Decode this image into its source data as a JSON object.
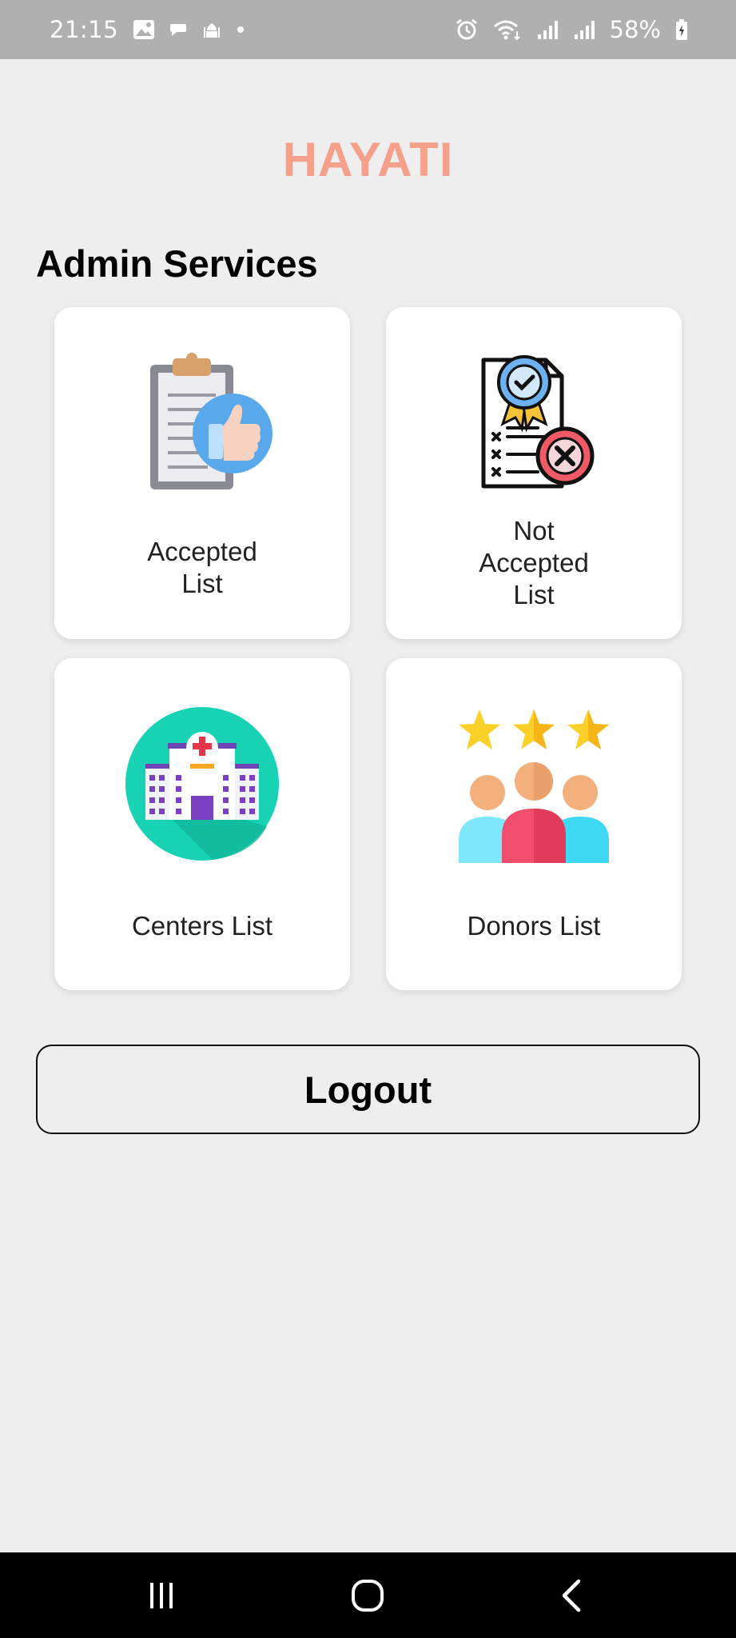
{
  "status_bar": {
    "time": "21:15",
    "battery": "58%",
    "icons": [
      "gallery-icon",
      "chat-icon",
      "mosque-icon",
      "dot-icon",
      "alarm-icon",
      "wifi-icon",
      "signal-icon",
      "signal-icon",
      "battery-icon"
    ]
  },
  "app": {
    "title": "HAYATI",
    "title_color": "#f5a08a"
  },
  "section": {
    "title": "Admin Services"
  },
  "cards": [
    {
      "id": "accepted",
      "icon": "clipboard-thumbs-up-icon",
      "label_lines": [
        "Accepted",
        "List"
      ]
    },
    {
      "id": "not_accepted",
      "icon": "certificate-rejected-icon",
      "label_lines": [
        "Not",
        "Accepted",
        "List"
      ]
    },
    {
      "id": "centers",
      "icon": "hospital-icon",
      "label": "Centers List"
    },
    {
      "id": "donors",
      "icon": "donors-stars-icon",
      "label": "Donors List"
    }
  ],
  "logout": {
    "label": "Logout"
  },
  "nav": {
    "icons": [
      "recent-apps-icon",
      "home-icon",
      "back-icon"
    ]
  }
}
